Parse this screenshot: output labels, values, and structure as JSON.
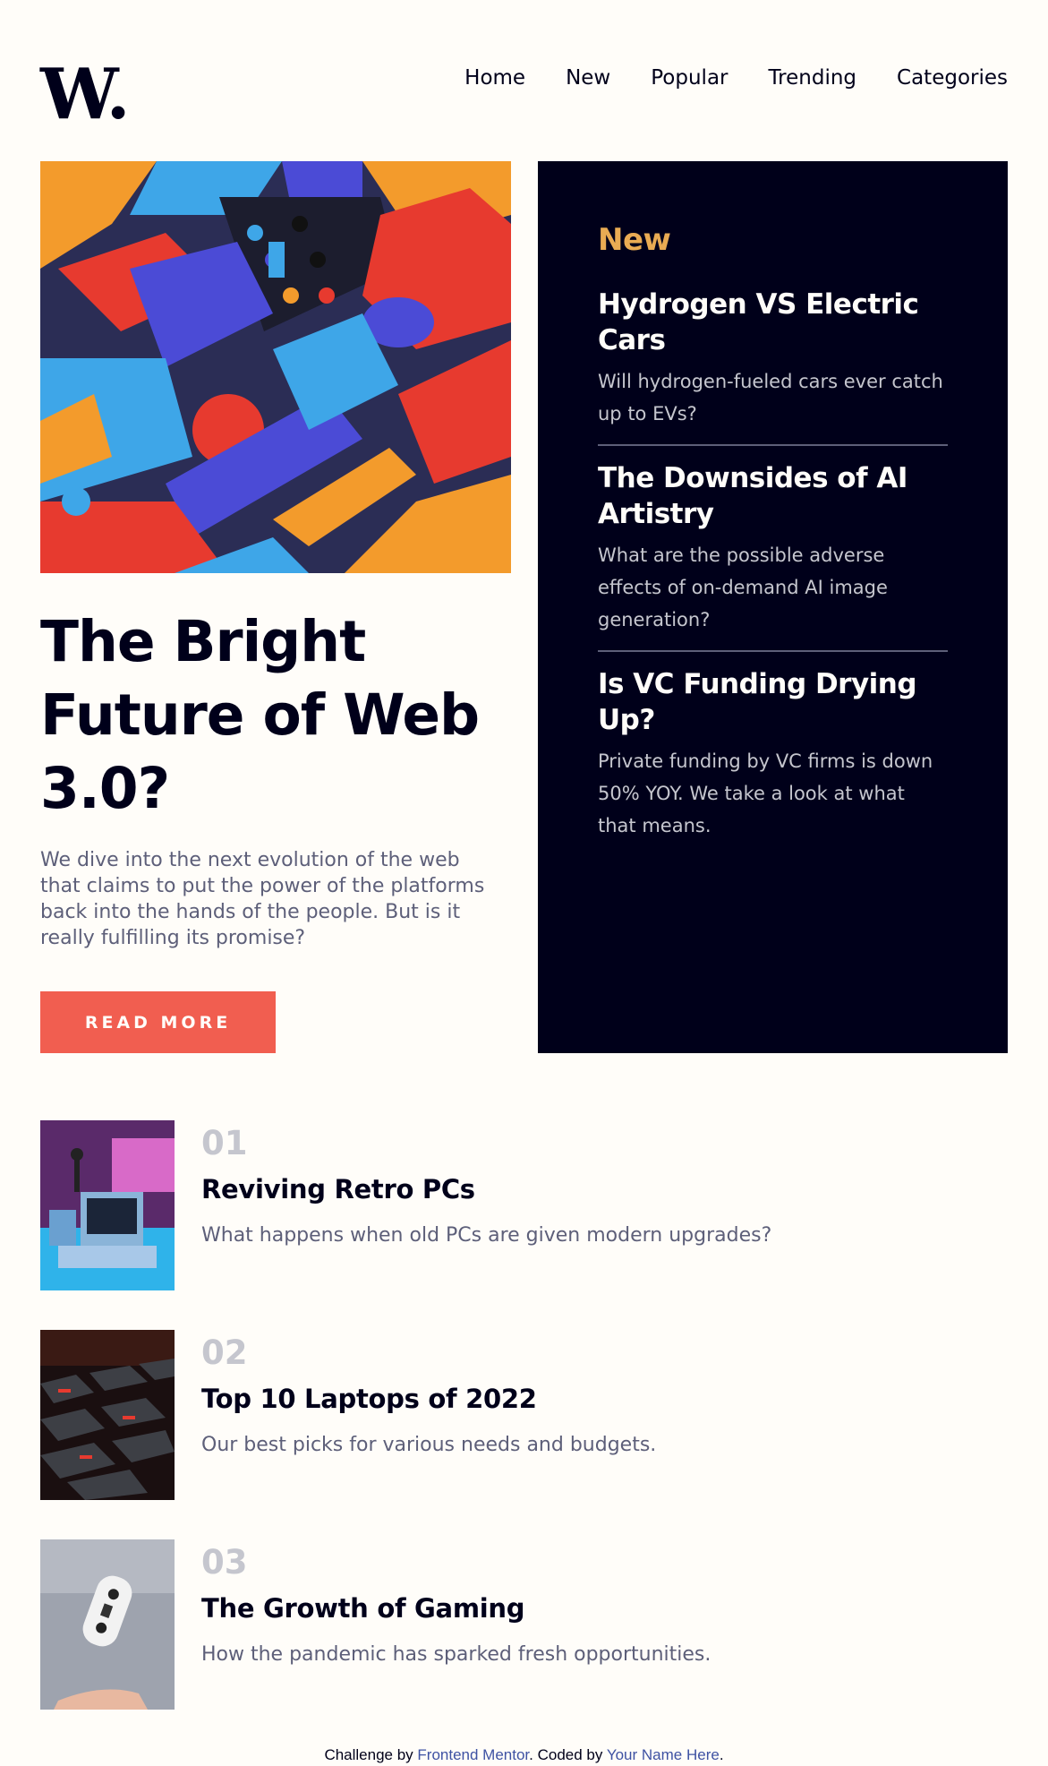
{
  "logo": "W.",
  "nav": [
    "Home",
    "New",
    "Popular",
    "Trending",
    "Categories"
  ],
  "hero": {
    "title": "The Bright Future of Web 3.0?",
    "text": "We dive into the next evolution of the web that claims to put the power of the platforms back into the hands of the people. But is it really fulfilling its promise?",
    "button": "READ MORE"
  },
  "new_panel": {
    "heading": "New",
    "items": [
      {
        "title": "Hydrogen VS Electric Cars",
        "text": "Will hydrogen-fueled cars ever catch up to EVs?"
      },
      {
        "title": "The Downsides of AI Artistry",
        "text": "What are the possible adverse effects of on-demand AI image generation?"
      },
      {
        "title": "Is VC Funding Drying Up?",
        "text": "Private funding by VC firms is down 50% YOY. We take a look at what that means."
      }
    ]
  },
  "list": [
    {
      "num": "01",
      "title": "Reviving Retro PCs",
      "text": "What happens when old PCs are given modern upgrades?"
    },
    {
      "num": "02",
      "title": "Top 10 Laptops of 2022",
      "text": "Our best picks for various needs and budgets."
    },
    {
      "num": "03",
      "title": "The Growth of Gaming",
      "text": "How the pandemic has sparked fresh opportunities."
    }
  ],
  "footer": {
    "prefix": "Challenge by",
    "link1": "Frontend Mentor",
    "middle": ". Coded by",
    "link2": "Your Name Here",
    "suffix": "."
  },
  "colors": {
    "background": "#fffdf9",
    "dark": "#00001a",
    "accent_red": "#f15e50",
    "accent_orange": "#e9ab53",
    "grey_blue": "#5d5f79",
    "link": "#3e52a3"
  }
}
